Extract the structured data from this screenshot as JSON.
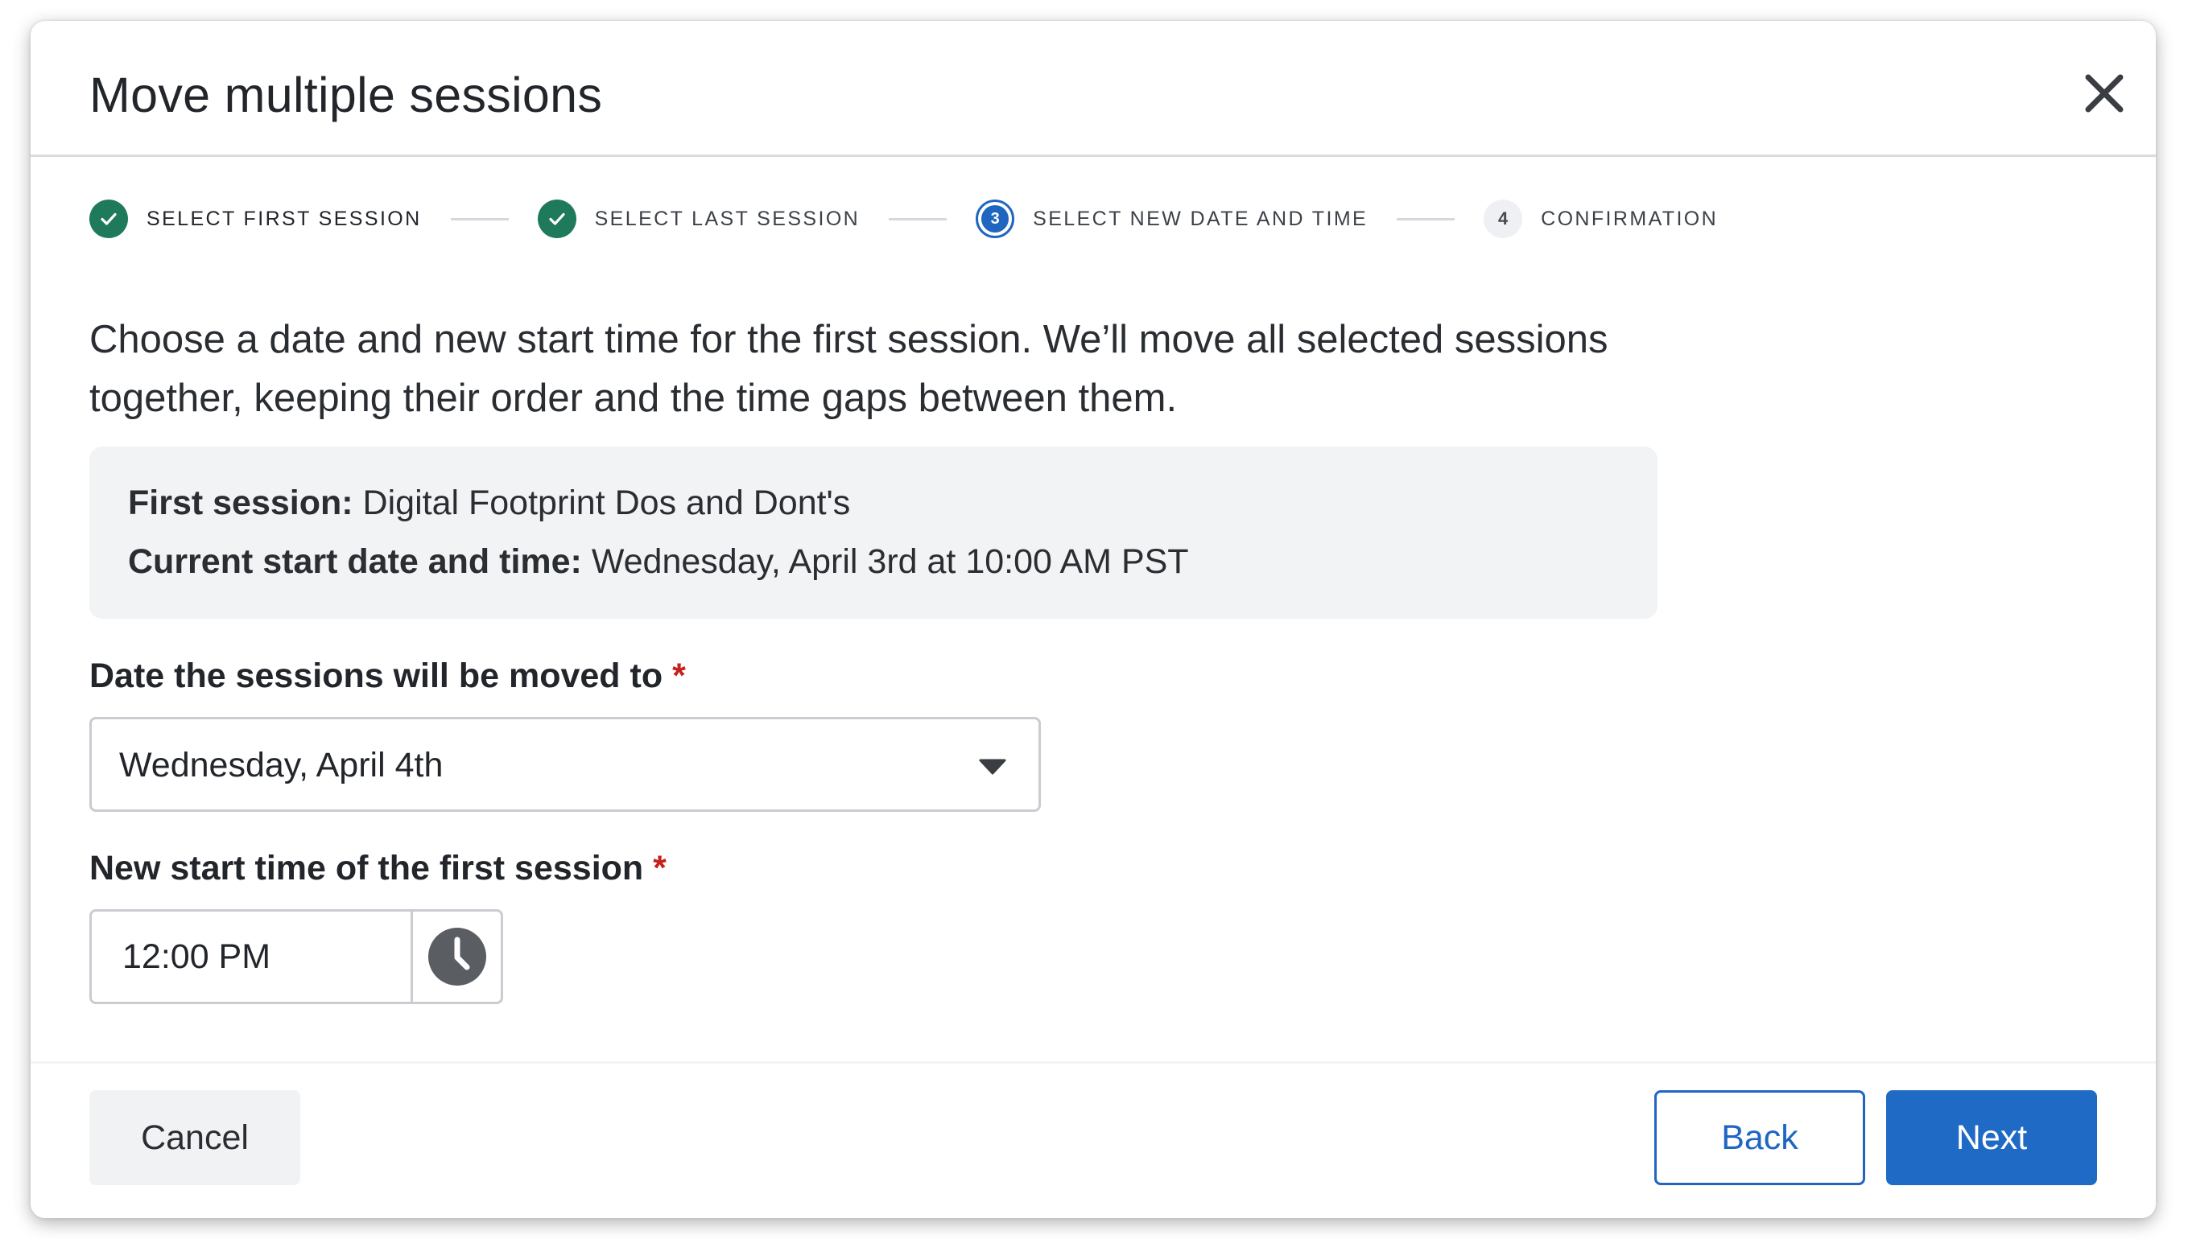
{
  "dialog": {
    "title": "Move multiple sessions",
    "close_icon": "close-icon"
  },
  "stepper": {
    "steps": [
      {
        "label": "SELECT FIRST SESSION",
        "status": "complete",
        "icon": "check-icon"
      },
      {
        "label": "SELECT LAST SESSION",
        "status": "complete",
        "icon": "check-icon"
      },
      {
        "label": "SELECT NEW DATE AND TIME",
        "status": "current",
        "number": "3"
      },
      {
        "label": "CONFIRMATION",
        "status": "pending",
        "number": "4"
      }
    ]
  },
  "description": "Choose a date and new start time for the first session. We’ll move all selected sessions together, keeping their order and the time gaps between them.",
  "info": {
    "first_session_label": "First session:",
    "first_session_value": "Digital Footprint Dos and Dont's",
    "current_start_label": "Current start date and time:",
    "current_start_value": "Wednesday, April 3rd at 10:00 AM PST"
  },
  "date_field": {
    "label": "Date the sessions will be moved to",
    "required_mark": "*",
    "value": "Wednesday, April 4th",
    "icon": "chevron-down-icon"
  },
  "time_field": {
    "label": "New start time of the first session",
    "required_mark": "*",
    "value": "12:00 PM",
    "icon": "clock-icon"
  },
  "footer": {
    "cancel_label": "Cancel",
    "back_label": "Back",
    "next_label": "Next"
  },
  "colors": {
    "primary": "#1f6ac4",
    "success": "#1e7a5a",
    "required": "#c5221f"
  }
}
